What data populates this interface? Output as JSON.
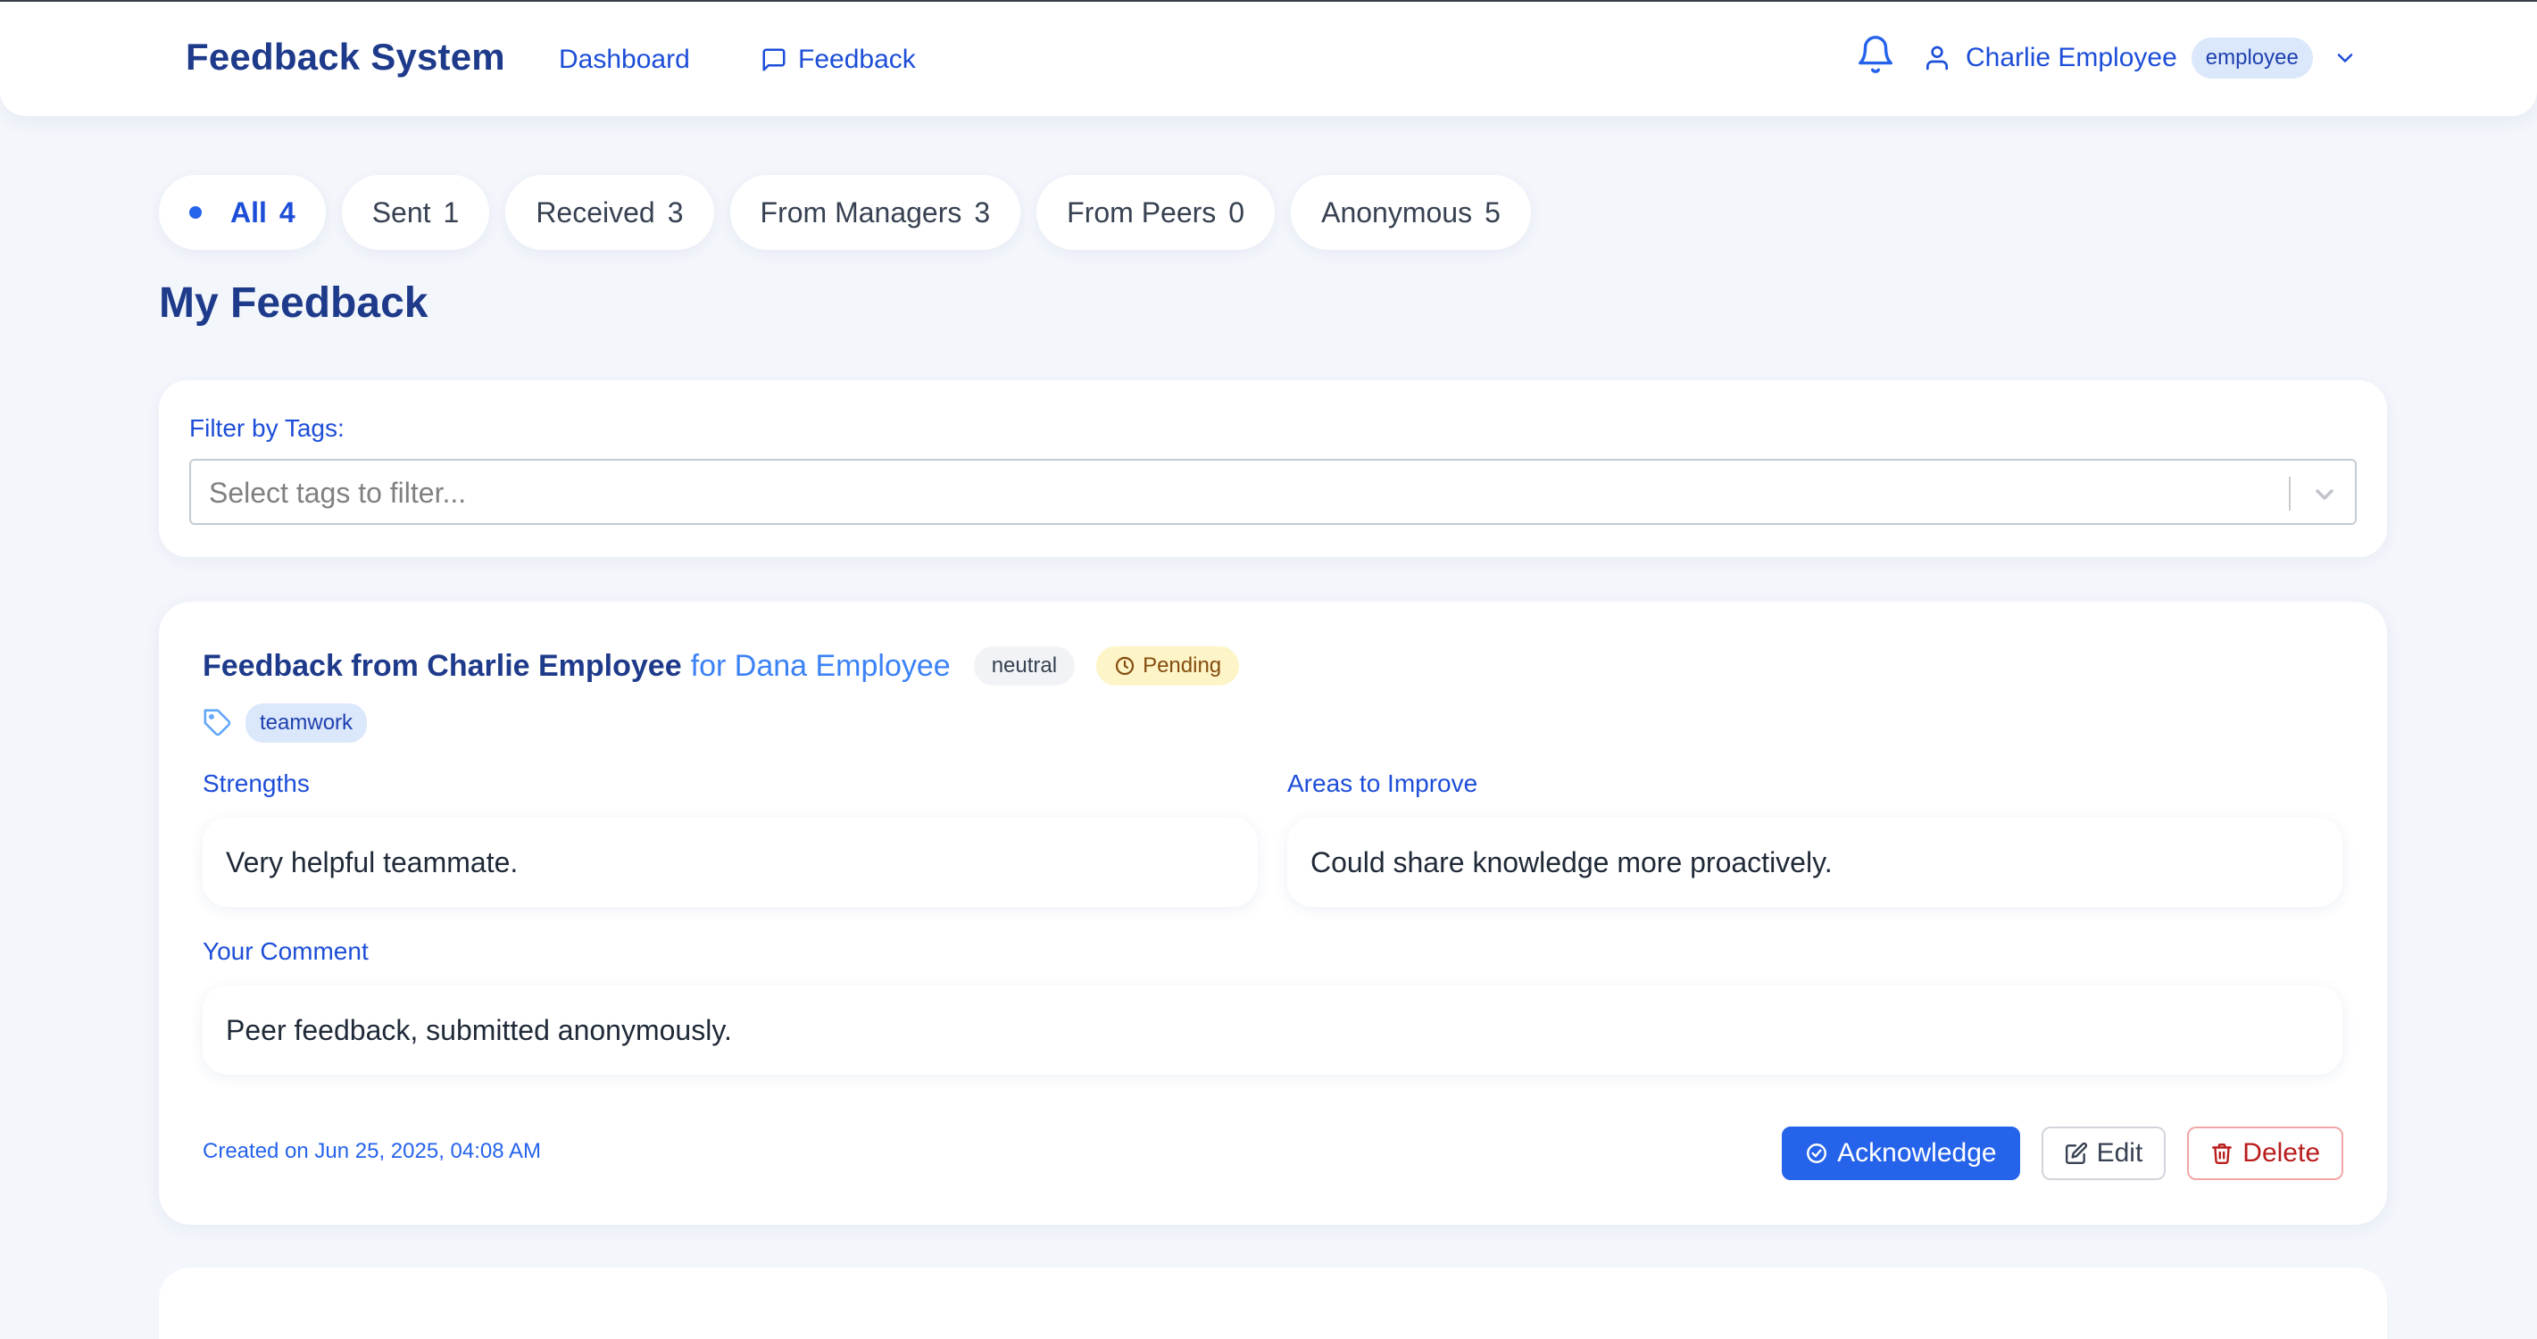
{
  "header": {
    "brand": "Feedback System",
    "nav": [
      {
        "label": "Dashboard",
        "icon": "none"
      },
      {
        "label": "Feedback",
        "icon": "message-square-icon"
      }
    ],
    "user": {
      "name": "Charlie Employee",
      "role": "employee"
    }
  },
  "tabs": [
    {
      "label": "All",
      "count": "4",
      "active": true
    },
    {
      "label": "Sent",
      "count": "1"
    },
    {
      "label": "Received",
      "count": "3"
    },
    {
      "label": "From Managers",
      "count": "3"
    },
    {
      "label": "From Peers",
      "count": "0"
    },
    {
      "label": "Anonymous",
      "count": "5"
    }
  ],
  "page_title": "My Feedback",
  "tag_filter": {
    "label": "Filter by Tags:",
    "placeholder": "Select tags to filter..."
  },
  "feedback": {
    "from": "Feedback from Charlie Employee",
    "for": "for Dana Employee",
    "sentiment": "neutral",
    "status": "Pending",
    "tags": [
      "teamwork"
    ],
    "strengths_label": "Strengths",
    "strengths": "Very helpful teammate.",
    "improve_label": "Areas to Improve",
    "improve": "Could share knowledge more proactively.",
    "comment_label": "Your Comment",
    "comment": "Peer feedback, submitted anonymously.",
    "created": "Created on Jun 25, 2025, 04:08 AM",
    "actions": {
      "acknowledge": "Acknowledge",
      "edit": "Edit",
      "delete": "Delete"
    }
  },
  "colors": {
    "primary": "#2563eb",
    "brand": "#1e3a8a",
    "pending_bg": "#fdf4c7",
    "danger": "#b91c1c",
    "page_bg": "#f3f6fb"
  }
}
